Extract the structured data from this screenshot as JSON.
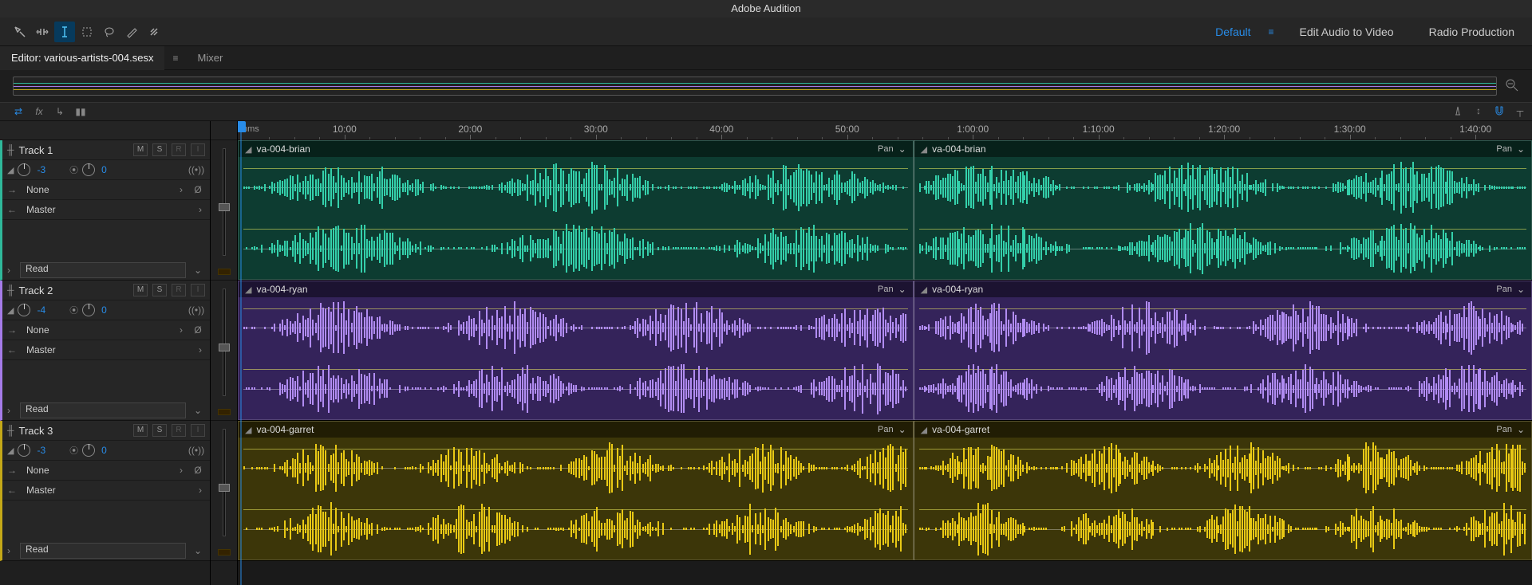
{
  "app_title": "Adobe Audition",
  "workspaces": {
    "items": [
      "Default",
      "Edit Audio to Video",
      "Radio Production"
    ],
    "active": "Default"
  },
  "panel_tabs": {
    "editor_label_prefix": "Editor:",
    "filename": "various-artists-004.sesx",
    "mixer_label": "Mixer"
  },
  "ruler": {
    "unit_label": "hms",
    "ticks": [
      "10:00",
      "20:00",
      "30:00",
      "40:00",
      "50:00",
      "1:00:00",
      "1:10:00",
      "1:20:00",
      "1:30:00",
      "1:40:00"
    ]
  },
  "tracks": [
    {
      "name": "Track 1",
      "gain": "-3",
      "pan": "0",
      "input": "None",
      "output": "Master",
      "automation": "Read",
      "color": "c0",
      "clips": [
        {
          "name": "va-004-brian",
          "pan_label": "Pan"
        },
        {
          "name": "va-004-brian",
          "pan_label": "Pan"
        }
      ]
    },
    {
      "name": "Track 2",
      "gain": "-4",
      "pan": "0",
      "input": "None",
      "output": "Master",
      "automation": "Read",
      "color": "c1",
      "clips": [
        {
          "name": "va-004-ryan",
          "pan_label": "Pan"
        },
        {
          "name": "va-004-ryan",
          "pan_label": "Pan"
        }
      ]
    },
    {
      "name": "Track 3",
      "gain": "-3",
      "pan": "0",
      "input": "None",
      "output": "Master",
      "automation": "Read",
      "color": "c2",
      "clips": [
        {
          "name": "va-004-garret",
          "pan_label": "Pan"
        },
        {
          "name": "va-004-garret",
          "pan_label": "Pan"
        }
      ]
    }
  ],
  "buttons": {
    "mute": "M",
    "solo": "S",
    "record": "R",
    "input_mon": "I"
  },
  "clip_split_percent": 52.2
}
